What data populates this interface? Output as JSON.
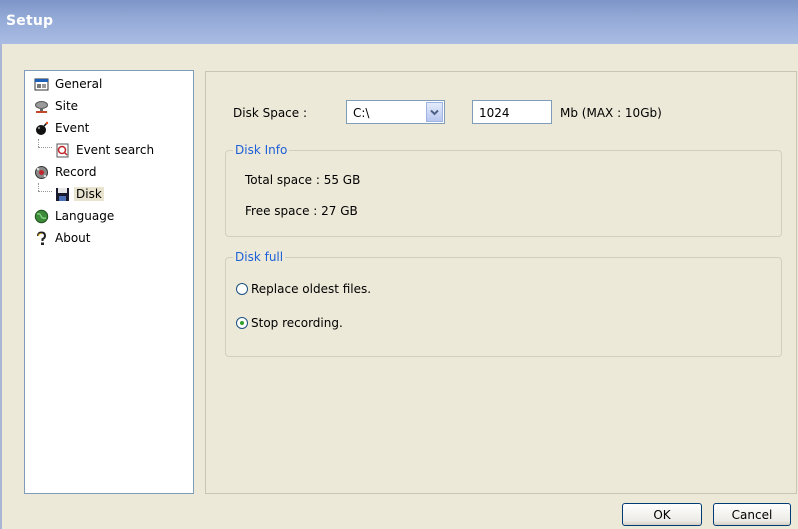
{
  "window": {
    "title": "Setup"
  },
  "tree": {
    "items": [
      {
        "label": "General",
        "icon": "general-icon"
      },
      {
        "label": "Site",
        "icon": "site-icon"
      },
      {
        "label": "Event",
        "icon": "event-icon"
      },
      {
        "label": "Event search",
        "icon": "event-search-icon"
      },
      {
        "label": "Record",
        "icon": "record-icon"
      },
      {
        "label": "Disk",
        "icon": "disk-icon",
        "selected": true
      },
      {
        "label": "Language",
        "icon": "language-icon"
      },
      {
        "label": "About",
        "icon": "about-icon"
      }
    ]
  },
  "disk_space": {
    "label": "Disk Space :",
    "drive": "C:\\",
    "size_value": "1024",
    "unit_text": "Mb (MAX : 10Gb)"
  },
  "disk_info": {
    "legend": "Disk Info",
    "total": "Total space : 55 GB",
    "free": "Free space : 27 GB"
  },
  "disk_full": {
    "legend": "Disk full",
    "options": [
      {
        "label": "Replace oldest files.",
        "checked": false
      },
      {
        "label": "Stop recording.",
        "checked": true
      }
    ]
  },
  "buttons": {
    "ok": "OK",
    "cancel": "Cancel"
  },
  "colors": {
    "title_bar": "#93a9d6",
    "legend_text": "#1c5fd8",
    "selection": "#e8e4cf"
  }
}
